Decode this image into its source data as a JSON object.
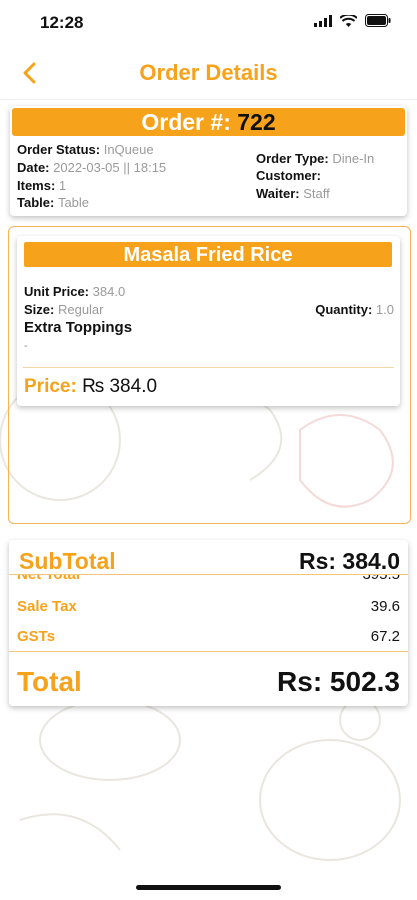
{
  "status_bar": {
    "time": "12:28"
  },
  "nav": {
    "title": "Order Details",
    "back_icon": "chevron-left-icon"
  },
  "order": {
    "number_label": "Order #:",
    "number": "722",
    "status_label": "Order Status:",
    "status": "InQueue",
    "date_label": "Date:",
    "date": "2022-03-05 || 18:15",
    "items_label": "Items:",
    "items": "1",
    "table_label": "Table:",
    "table": "Table",
    "order_type_label": "Order Type:",
    "order_type": "Dine-In",
    "customer_label": "Customer:",
    "customer": "",
    "waiter_label": "Waiter:",
    "waiter": "Staff"
  },
  "item": {
    "name": "Masala Fried Rice",
    "unit_price_label": "Unit Price:",
    "unit_price": "384.0",
    "size_label": "Size:",
    "size": "Regular",
    "quantity_label": "Quantity:",
    "quantity": "1.0",
    "toppings_label": "Extra Toppings",
    "toppings": "-",
    "price_label": "Price:",
    "price": "₨ 384.0"
  },
  "totals": {
    "subtotal_label": "SubTotal",
    "subtotal": "Rs: 384.0",
    "net_total_label": "Net Total",
    "net_total": "395.5",
    "sale_tax_label": "Sale Tax",
    "sale_tax": "39.6",
    "gst_label": "GSTs",
    "gst": "67.2",
    "total_label": "Total",
    "total": "Rs: 502.3"
  },
  "colors": {
    "accent": "#f7a21b"
  }
}
